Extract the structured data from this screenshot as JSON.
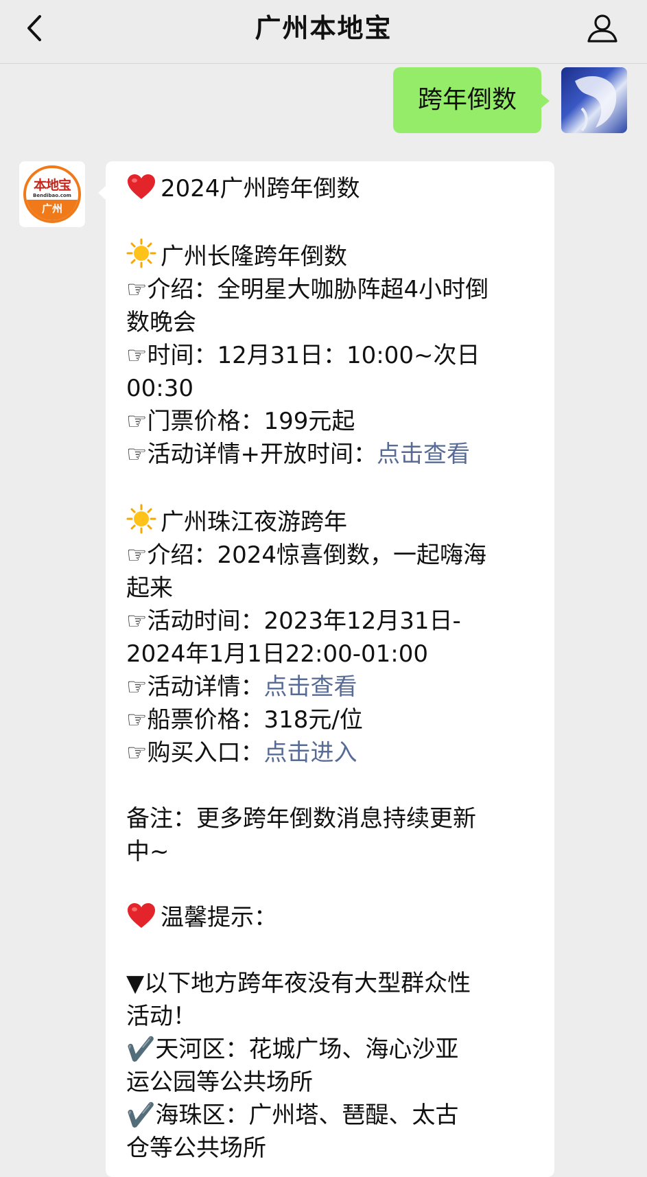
{
  "header": {
    "title": "广州本地宝",
    "back_icon": "chevron-left-icon",
    "profile_icon": "person-icon"
  },
  "user_message": {
    "text": "跨年倒数"
  },
  "bot": {
    "avatar": {
      "logo_top": "本地宝",
      "site": "Bendibao.com",
      "city": "广州"
    },
    "lines": {
      "l1": "2024广州跨年倒数",
      "s1_title": "广州长隆跨年倒数",
      "s1_intro_a": "☞介绍：全明星大咖胁阵超4小时倒",
      "s1_intro_b": "数晚会",
      "s1_time_a": "☞时间：12月31日：10:00~次日",
      "s1_time_b": "00:30",
      "s1_price": "☞门票价格：199元起",
      "s1_detail_label": "☞活动详情+开放时间：",
      "s1_detail_link": "点击查看",
      "s2_title": "广州珠江夜游跨年",
      "s2_intro_a": "☞介绍：2024惊喜倒数，一起嗨海",
      "s2_intro_b": "起来",
      "s2_time_a": "☞活动时间：2023年12月31日-",
      "s2_time_b": "2024年1月1日22:00-01:00",
      "s2_detail_label": "☞活动详情：",
      "s2_detail_link": "点击查看",
      "s2_price": "☞船票价格：318元/位",
      "s2_buy_label": "☞购买入口：",
      "s2_buy_link": "点击进入",
      "note_a": "备注：更多跨年倒数消息持续更新",
      "note_b": "中~",
      "tip": "温馨提示：",
      "warn_a": "▼以下地方跨年夜没有大型群众性",
      "warn_b": "活动！",
      "th_a": "✔️天河区：花城广场、海心沙亚",
      "th_b": "运公园等公共场所",
      "hz_a": "✔️海珠区：广州塔、琶醍、太古",
      "hz_b": "仓等公共场所"
    }
  },
  "colors": {
    "page_bg": "#ededed",
    "outgoing_bubble": "#95ec69",
    "incoming_bubble": "#ffffff",
    "link": "#576b95",
    "brand_orange": "#f07a1a"
  },
  "icons": {
    "heart": "red-heart-icon",
    "sun": "sun-icon"
  }
}
